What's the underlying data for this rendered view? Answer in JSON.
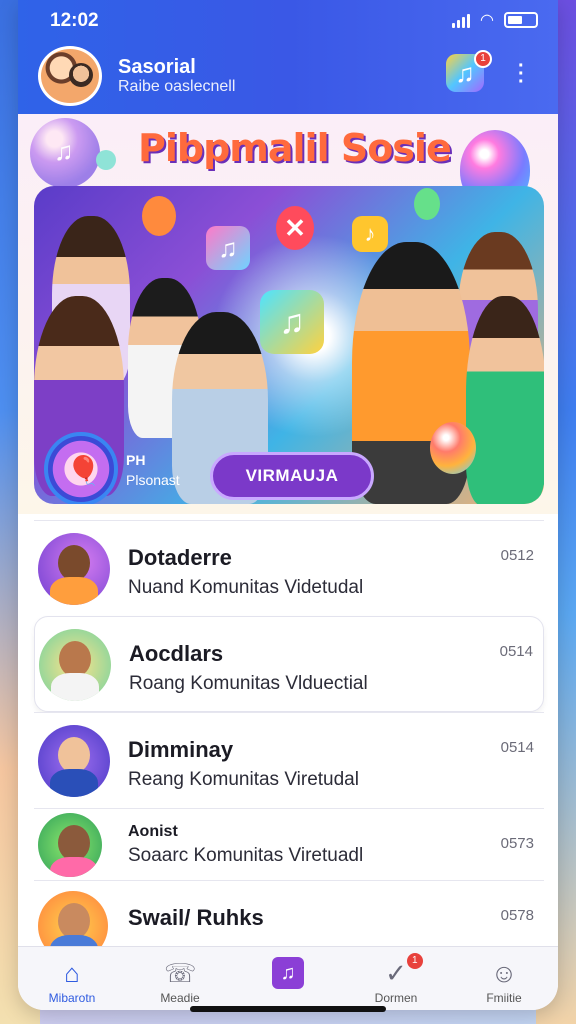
{
  "status_bar": {
    "time": "12:02"
  },
  "header": {
    "title": "Sasorial",
    "subtitle": "Raibe oaslecnell",
    "music_badge": "1"
  },
  "banner": {
    "title": "Pibpmalil Sosie",
    "badge_title": "PH",
    "badge_subtitle": "Plsonast",
    "button_label": "VIRMAUJA",
    "colors": {
      "button": "#7b39c9",
      "header": "#2f63e8"
    }
  },
  "chats": [
    {
      "name": "Dotaderre",
      "message": "Nuand Komunitas Videtudal",
      "time": "0512"
    },
    {
      "name": "Aocdlars",
      "message": "Roang Komunitas Vlduectial",
      "time": "0514"
    },
    {
      "name": "Dimminay",
      "message": "Reang Komunitas Viretudal",
      "time": "0514"
    },
    {
      "name": "Aonist",
      "message": "Soaarc Komunitas Viretuadl",
      "time": "0573"
    },
    {
      "name": "Swail/ Ruhks",
      "message": "",
      "time": "0578"
    }
  ],
  "tabs": [
    {
      "label": "Mibarotn",
      "icon": "home-icon"
    },
    {
      "label": "Meadie",
      "icon": "chat-icon"
    },
    {
      "label": "",
      "icon": "music-note-icon"
    },
    {
      "label": "Dormen",
      "icon": "check-icon",
      "badge": "1"
    },
    {
      "label": "Fmiitie",
      "icon": "profile-icon"
    }
  ]
}
